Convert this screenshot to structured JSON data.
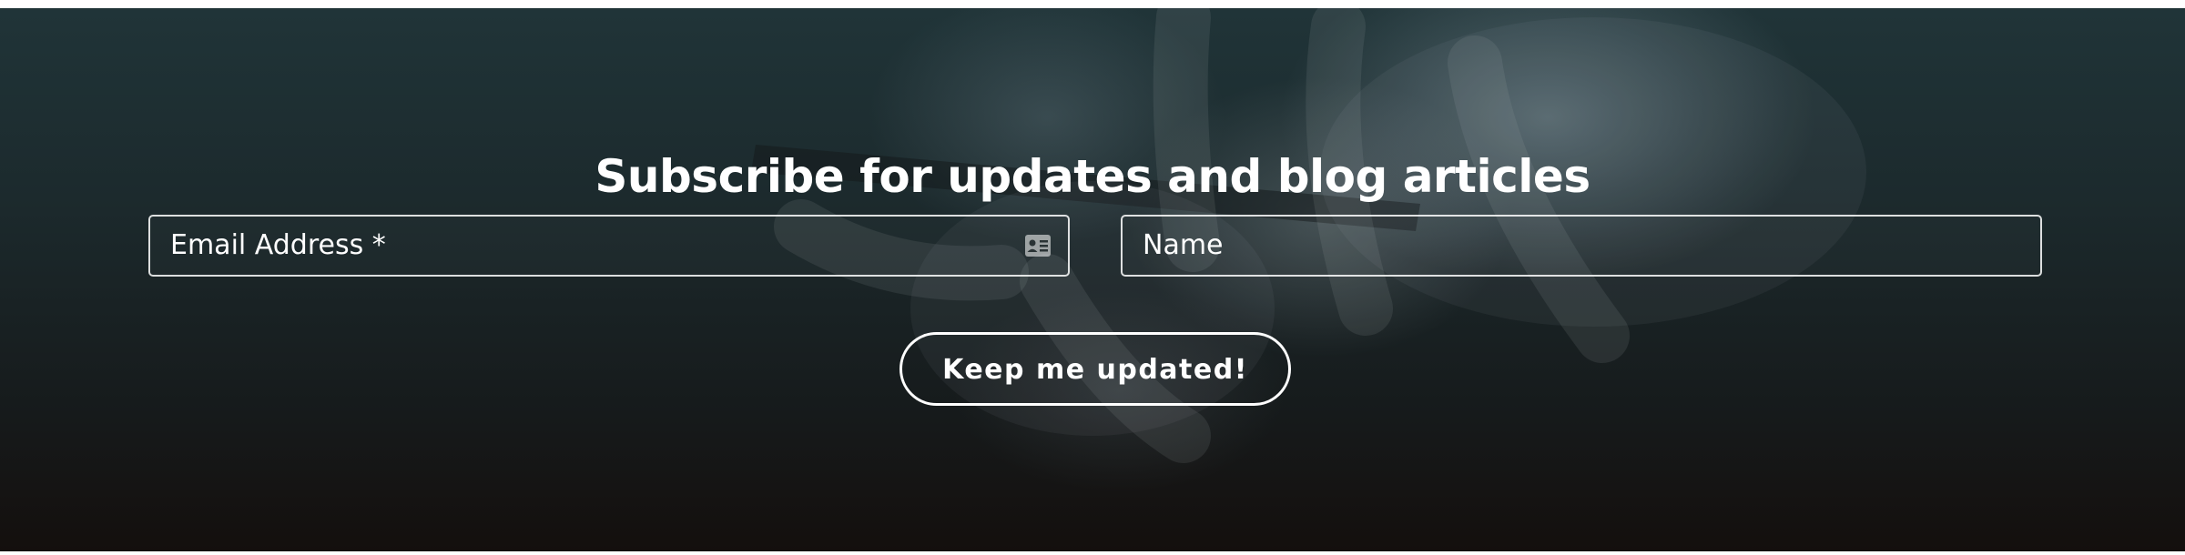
{
  "newsletter": {
    "title": "Subscribe for updates and blog articles",
    "email_placeholder": "Email Address *",
    "name_placeholder": "Name",
    "submit_label": "Keep me updated!",
    "email_icon": "contact-card-icon",
    "colors": {
      "text": "#ffffff",
      "overlay_top": "#203438",
      "overlay_bottom": "#140f0d"
    }
  }
}
